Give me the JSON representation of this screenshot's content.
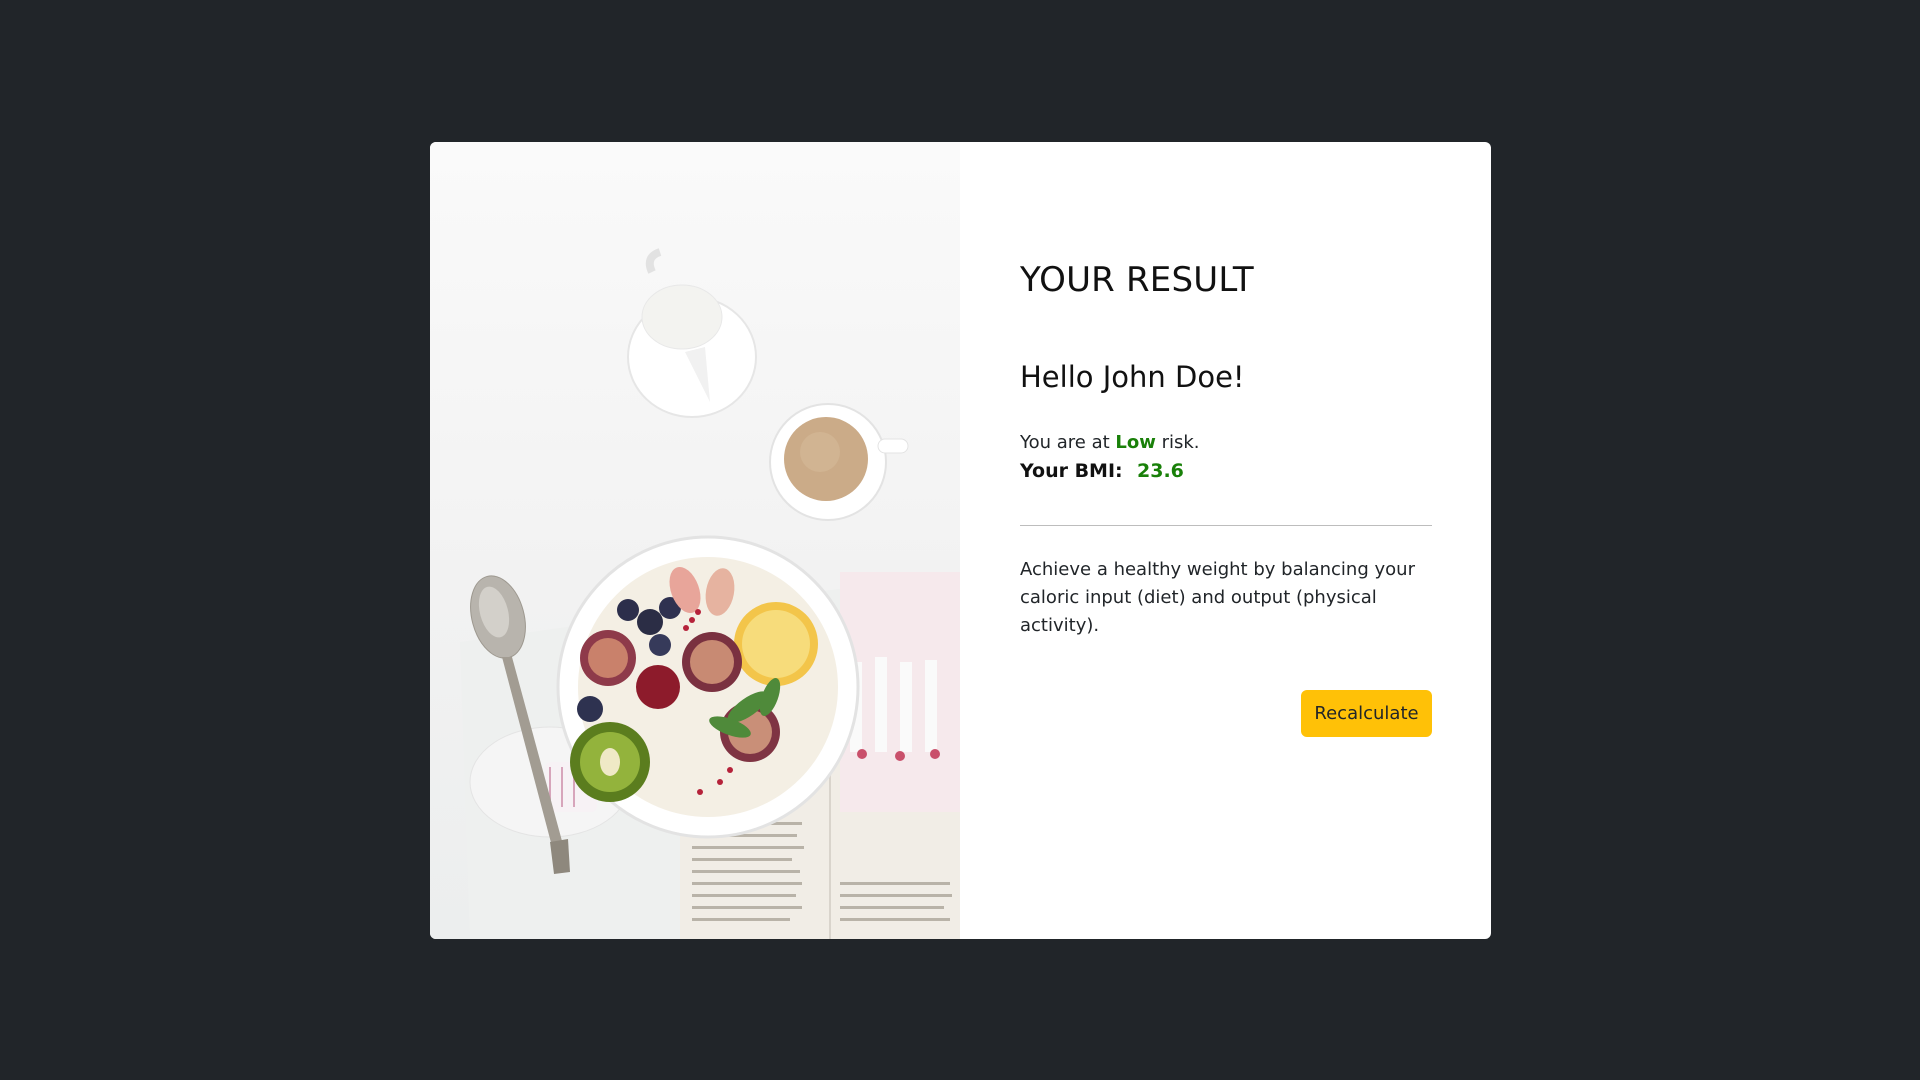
{
  "result": {
    "title": "YOUR RESULT",
    "greeting": "Hello John Doe!",
    "risk_prefix": "You are at ",
    "risk_level": "Low",
    "risk_suffix": " risk.",
    "bmi_label": "Your BMI:",
    "bmi_value": "23.6",
    "advice": "Achieve a healthy weight by balancing your caloric input (diet) and output (physical activity).",
    "recalculate_label": "Recalculate"
  },
  "image": {
    "subject": "fruit-bowl-breakfast-photo"
  },
  "colors": {
    "page_background": "#212529",
    "card_background": "#ffffff",
    "risk_low": "#198009",
    "button": "#ffc107"
  }
}
